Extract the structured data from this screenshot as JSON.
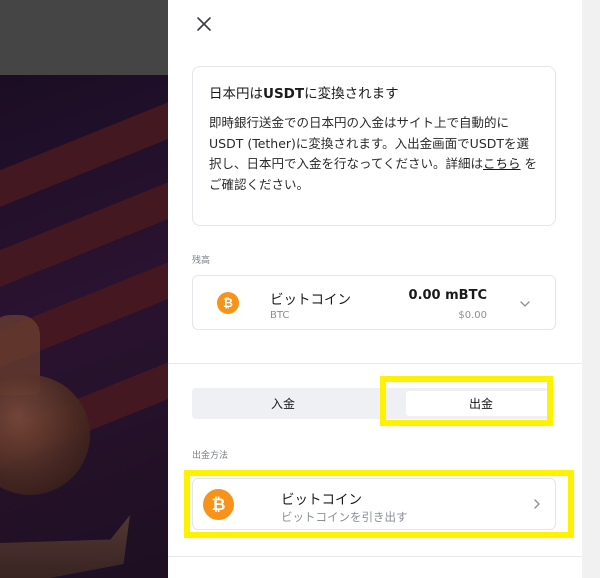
{
  "notice": {
    "title_prefix": "日本円は",
    "title_bold": "USDT",
    "title_suffix": "に変換されます",
    "body_text": "即時銀行送金での日本円の入金はサイト上で自動的にUSDT (Tether)に変換されます。入出金画面でUSDTを選択し、日本円で入金を行なってください。詳細は",
    "link_text": "こちら",
    "body_suffix": " をご確認ください。"
  },
  "balance": {
    "label": "残高",
    "currency_name": "ビットコイン",
    "currency_code": "BTC",
    "amount": "0.00 mBTC",
    "fiat_value": "$0.00",
    "coin_icon": "bitcoin-icon"
  },
  "tabs": [
    {
      "label": "入金",
      "active": false
    },
    {
      "label": "出金",
      "active": true
    }
  ],
  "withdraw_method": {
    "label": "出金方法",
    "name": "ビットコイン",
    "description": "ビットコインを引き出す",
    "coin_icon": "bitcoin-icon"
  },
  "colors": {
    "bitcoin": "#f7931a",
    "highlight": "#fff200"
  }
}
